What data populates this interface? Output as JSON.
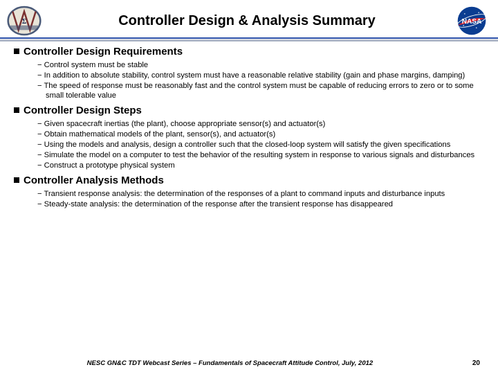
{
  "header": {
    "title": "Controller Design & Analysis Summary"
  },
  "sections": [
    {
      "heading": "Controller Design Requirements",
      "items": [
        "Control system must be stable",
        "In addition to absolute stability, control system must have a reasonable relative stability (gain and phase margins, damping)",
        "The speed of response must be reasonably fast and the control system must be capable of reducing errors to zero or to some small tolerable value"
      ]
    },
    {
      "heading": "Controller Design Steps",
      "items": [
        "Given spacecraft inertias (the plant), choose appropriate sensor(s) and actuator(s)",
        "Obtain mathematical models of the plant, sensor(s), and actuator(s)",
        "Using the models and analysis, design a controller such that the closed-loop system will satisfy the given specifications",
        "Simulate the model on a computer to test the behavior of the resulting system in response to various signals and disturbances",
        "Construct a prototype physical system"
      ]
    },
    {
      "heading": "Controller Analysis Methods",
      "items": [
        "Transient response analysis: the determination of the responses of a plant to command inputs and disturbance inputs",
        "Steady-state analysis: the determination of the response after the transient response has disappeared"
      ]
    }
  ],
  "footer": {
    "text": "NESC GN&C TDT Webcast Series – Fundamentals of Spacecraft Attitude Control, July, 2012",
    "page": "20"
  }
}
